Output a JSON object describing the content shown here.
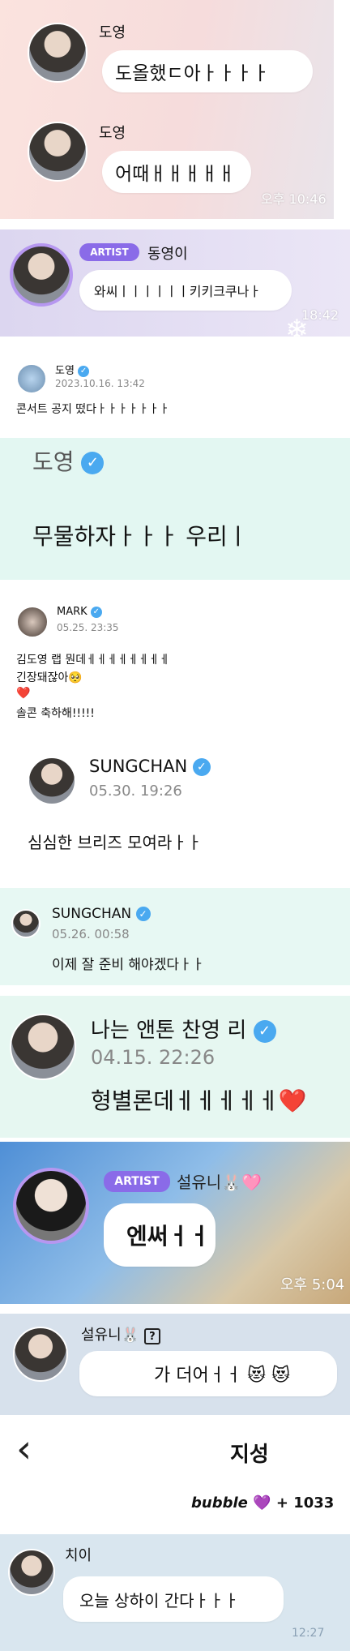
{
  "p1": {
    "messages": [
      {
        "name": "도영",
        "text": "도올했ㄷ아ㅏㅏㅏㅏ"
      },
      {
        "name": "도영",
        "text": "어때ㅐㅐㅐㅐㅐ"
      }
    ],
    "time": "오후 10:46"
  },
  "p2": {
    "badge": "ARTIST",
    "name": "동영이",
    "text": "와씨ㅣㅣㅣㅣㅣㅣ키키크쿠나ㅏ",
    "time": "18:42"
  },
  "p3": {
    "name": "도영",
    "date": "2023.10.16. 13:42",
    "text": "콘서트 공지 떴다ㅏㅏㅏㅏㅏㅏㅏ"
  },
  "p4": {
    "name": "도영",
    "text": "무물하자ㅏㅏㅏ 우리ㅣ"
  },
  "p5": {
    "name": "MARK",
    "date": "05.25. 23:35",
    "lines": [
      "김도영 랩 뭔데ㅔㅔㅔㅔㅔㅔㅔㅔ",
      "긴장돼잖아🥺",
      "❤️",
      "솔콘 축하해!!!!!"
    ]
  },
  "p6": {
    "name": "SUNGCHAN",
    "date": "05.30. 19:26",
    "text": "심심한 브리즈 모여라ㅏㅏ"
  },
  "p7": {
    "name": "SUNGCHAN",
    "date": "05.26. 00:58",
    "text": "이제 잘 준비 해야겠다ㅏㅏ"
  },
  "p8": {
    "name": "나는 앤톤 찬영 리",
    "date": "04.15. 22:26",
    "text": "형별론데ㅔㅔㅔㅔㅔ",
    "heart": "❤️"
  },
  "p9": {
    "badge": "ARTIST",
    "name": "설유니",
    "emoji": "🐰🩷",
    "text": "엔써ㅓㅓ",
    "time": "오후 5:04"
  },
  "p10": {
    "name": "설유니",
    "emoji": "🐰",
    "qmark": "?",
    "text": "가 더어ㅓㅓ 😻 😻"
  },
  "p11": {
    "back": "‹",
    "title": "지성",
    "brand": "bubble",
    "heart": "💜",
    "count": "+ 1033"
  },
  "p12": {
    "name": "치이",
    "text": "오늘 상하이 간다ㅏㅏㅏ",
    "time": "12:27"
  },
  "colors": {
    "verified": "#4aa9f0",
    "artist": "#8a6be8",
    "mint": "#e3f7f2",
    "lavender": "#e4e1f4"
  }
}
